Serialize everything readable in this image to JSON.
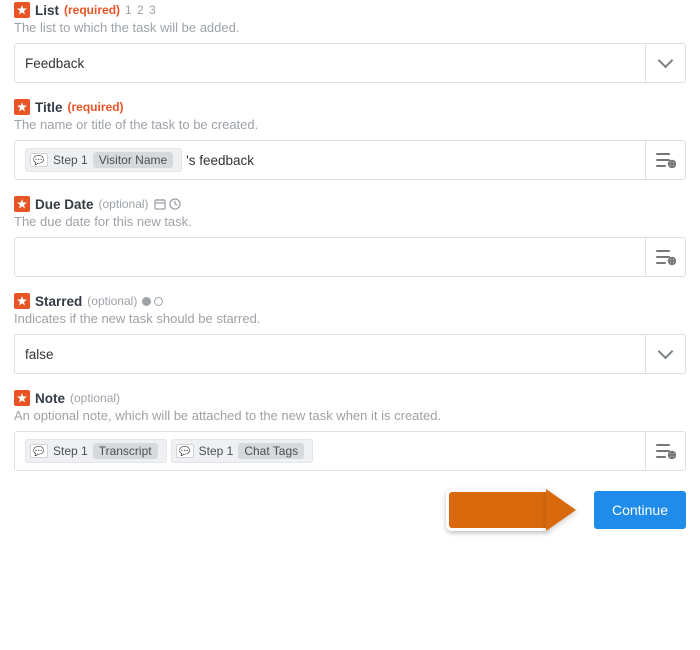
{
  "fields": {
    "list": {
      "label": "List",
      "req": "(required)",
      "hint123": "1 2 3",
      "desc": "The list to which the task will be added.",
      "value": "Feedback"
    },
    "title": {
      "label": "Title",
      "req": "(required)",
      "desc": "The name or title of the task to be created.",
      "token_step": "Step 1",
      "token_var": "Visitor Name",
      "suffix": "'s feedback"
    },
    "due": {
      "label": "Due Date",
      "opt": "(optional)",
      "desc": "The due date for this new task."
    },
    "starred": {
      "label": "Starred",
      "opt": "(optional)",
      "desc": "Indicates if the new task should be starred.",
      "value": "false"
    },
    "note": {
      "label": "Note",
      "opt": "(optional)",
      "desc": "An optional note, which will be attached to the new task when it is created.",
      "token1_step": "Step 1",
      "token1_var": "Transcript",
      "token2_step": "Step 1",
      "token2_var": "Chat Tags"
    }
  },
  "actions": {
    "continue": "Continue"
  },
  "icons": {
    "app": "wunderlist-icon"
  }
}
